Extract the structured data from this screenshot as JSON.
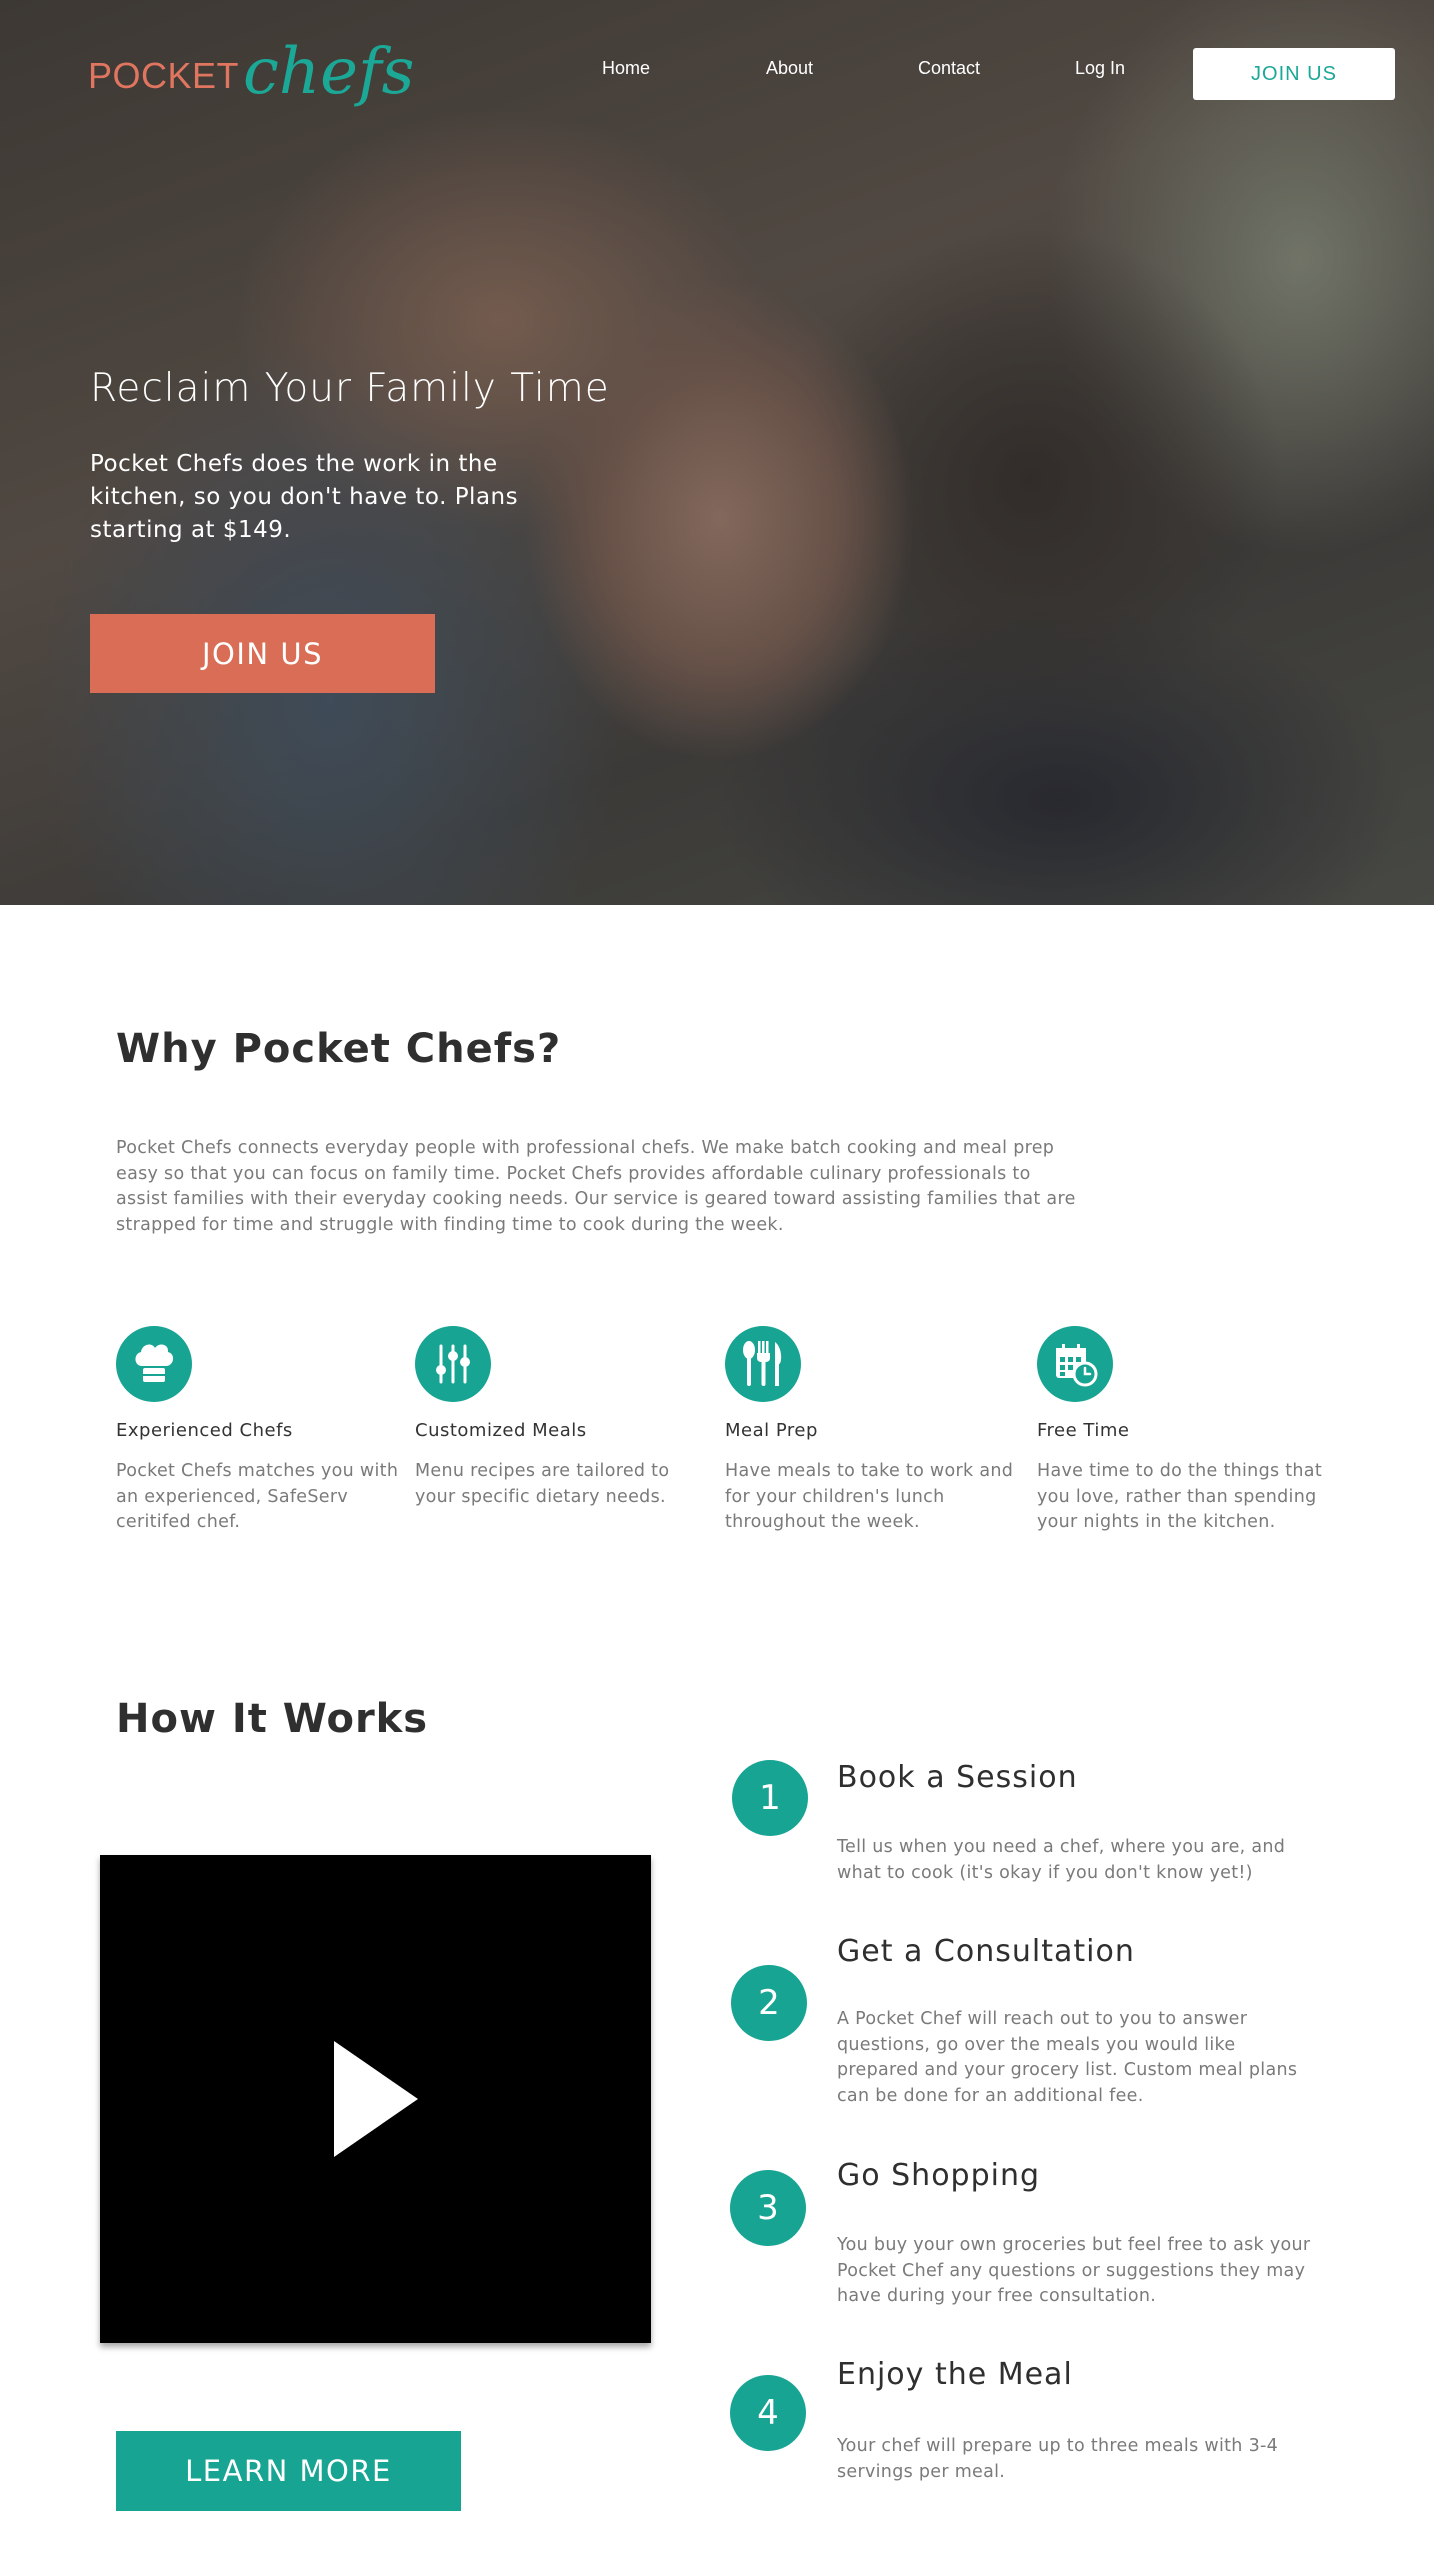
{
  "header": {
    "logo_word": "POCKET",
    "logo_script": "chefs",
    "nav": [
      "Home",
      "About",
      "Contact",
      "Log In"
    ],
    "join_label": "JOIN US"
  },
  "hero": {
    "title": "Reclaim Your Family Time",
    "subtitle": "Pocket Chefs does the work in the kitchen, so you don't have to. Plans starting at $149.",
    "cta": "JOIN US"
  },
  "why": {
    "title": "Why Pocket Chefs?",
    "body": "Pocket Chefs connects everyday people with professional chefs. We make batch cooking and meal prep easy so that you can focus on family time. Pocket Chefs provides affordable culinary professionals to assist families with their everyday cooking needs. Our service is geared toward assisting families that are strapped for time and struggle with finding time to cook during the week.",
    "features": [
      {
        "icon": "chef-hat-icon",
        "title": "Experienced Chefs",
        "desc": "Pocket Chefs matches you with an experienced, SafeServ ceritifed chef."
      },
      {
        "icon": "sliders-icon",
        "title": "Customized Meals",
        "desc": "Menu recipes are tailored to your specific dietary needs."
      },
      {
        "icon": "utensils-icon",
        "title": "Meal Prep",
        "desc": "Have meals to take to work and for your children's lunch throughout the week."
      },
      {
        "icon": "calendar-clock-icon",
        "title": "Free Time",
        "desc": "Have time to do the things that you love, rather than spending your nights in the kitchen."
      }
    ]
  },
  "how": {
    "title": "How It Works",
    "learn_more": "LEARN MORE",
    "steps": [
      {
        "num": "1",
        "title": "Book a Session",
        "desc": "Tell us when you need a chef, where you are, and what to cook (it's okay if you don't know yet!)"
      },
      {
        "num": "2",
        "title": "Get a Consultation",
        "desc": "A Pocket Chef will reach out to you to answer questions, go over the meals you would like prepared and your grocery list. Custom meal plans can be done for an additional fee."
      },
      {
        "num": "3",
        "title": "Go Shopping",
        "desc": "You buy your own groceries but feel free to ask your Pocket Chef any questions or suggestions they may have during your free consultation."
      },
      {
        "num": "4",
        "title": "Enjoy the Meal",
        "desc": "Your chef will prepare up to three meals with 3-4 servings per meal."
      }
    ]
  },
  "colors": {
    "teal": "#17a493",
    "coral": "#d96d55",
    "text_gray": "#7a7a7a"
  }
}
